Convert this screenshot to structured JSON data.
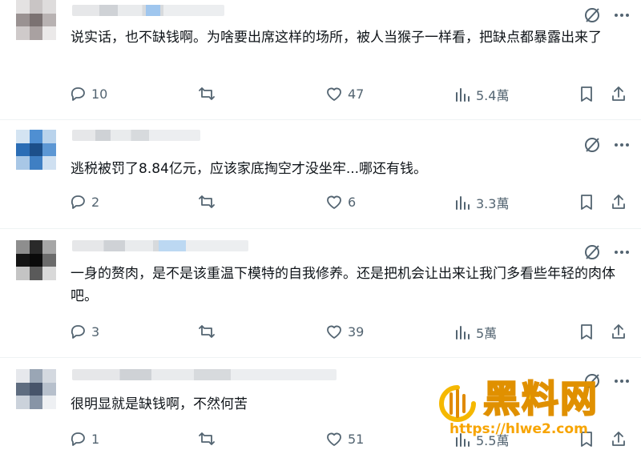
{
  "colors": {
    "text": "#0f1419",
    "muted": "#536471",
    "separator": "#eff3f4",
    "watermark_fill": "#f5c400",
    "watermark_url": "#f7a400"
  },
  "icons": {
    "reply": "speech-bubble-icon",
    "repost": "repost-arrows-icon",
    "like": "heart-icon",
    "views": "bar-chart-icon",
    "bookmark": "bookmark-icon",
    "share": "share-upload-icon",
    "grok": "grok-slash-circle-icon",
    "more": "more-dots-icon"
  },
  "posts": [
    {
      "text": "说实话，也不缺钱啊。为啥要出席这样的场所，被人当猴子一样看，把缺点都暴露出来了",
      "replies": "10",
      "likes": "47",
      "views": "5.4萬"
    },
    {
      "text": "逃税被罚了8.84亿元，应该家底掏空才没坐牢...哪还有钱。",
      "replies": "2",
      "likes": "6",
      "views": "3.3萬"
    },
    {
      "text": "一身的赘肉，是不是该重温下模特的自我修养。还是把机会让出来让我门多看些年轻的肉体吧。",
      "replies": "3",
      "likes": "39",
      "views": "5萬"
    },
    {
      "text": "很明显就是缺钱啊，不然何苦",
      "replies": "1",
      "likes": "51",
      "views": "5.5萬"
    }
  ],
  "watermark": {
    "title": "黑料网",
    "url": "https://hlwe2.com"
  }
}
